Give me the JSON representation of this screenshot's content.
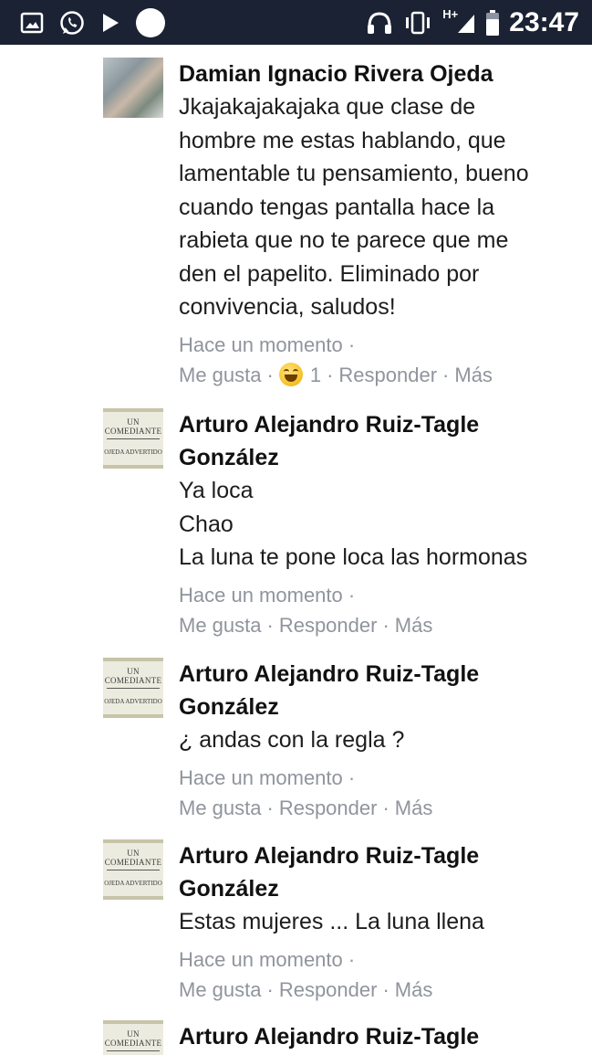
{
  "status_bar": {
    "icons_left": [
      "image-icon",
      "whatsapp-icon",
      "play-icon",
      "circle-icon"
    ],
    "icons_right": [
      "headphones-icon",
      "vibrate-icon",
      "signal-icon",
      "battery-icon"
    ],
    "network_label": "H+",
    "time": "23:47"
  },
  "comments": [
    {
      "author": "Damian Ignacio Rivera Ojeda",
      "lines": [
        "Jkajakajakajaka que clase de",
        "hombre me estas hablando, que",
        "lamentable tu pensamiento, bueno",
        "cuando tengas pantalla hace la",
        "rabieta que no te parece que me",
        "den el papelito. Eliminado por",
        "convivencia, saludos!"
      ],
      "timestamp": "Hace un momento ·",
      "like": "Me gusta",
      "reaction_count": "1",
      "reply": "Responder",
      "more": "Más",
      "separator": "·"
    },
    {
      "author_line1": "Arturo Alejandro Ruiz-Tagle",
      "author_line2": "González",
      "lines": [
        "Ya loca",
        "Chao",
        "La luna te pone loca las hormonas"
      ],
      "timestamp": "Hace un momento ·",
      "like": "Me gusta",
      "reply": "Responder",
      "more": "Más",
      "separator": "·"
    },
    {
      "author_line1": "Arturo Alejandro Ruiz-Tagle",
      "author_line2": "González",
      "lines": [
        "¿ andas con la regla ?"
      ],
      "timestamp": "Hace un momento ·",
      "like": "Me gusta",
      "reply": "Responder",
      "more": "Más",
      "separator": "·"
    },
    {
      "author_line1": "Arturo Alejandro Ruiz-Tagle",
      "author_line2": "González",
      "lines": [
        "Estas mujeres ... La luna llena"
      ],
      "timestamp": "Hace un momento ·",
      "like": "Me gusta",
      "reply": "Responder",
      "more": "Más",
      "separator": "·"
    },
    {
      "author_line1": "Arturo Alejandro Ruiz-Tagle"
    }
  ],
  "avatar_card": {
    "line1": "UN COMEDIANTE",
    "line2": "OJEDA ADVERTIDO"
  },
  "colors": {
    "status_bar": "#1b2233",
    "meta_text": "#90949c",
    "author_text": "#111111"
  }
}
